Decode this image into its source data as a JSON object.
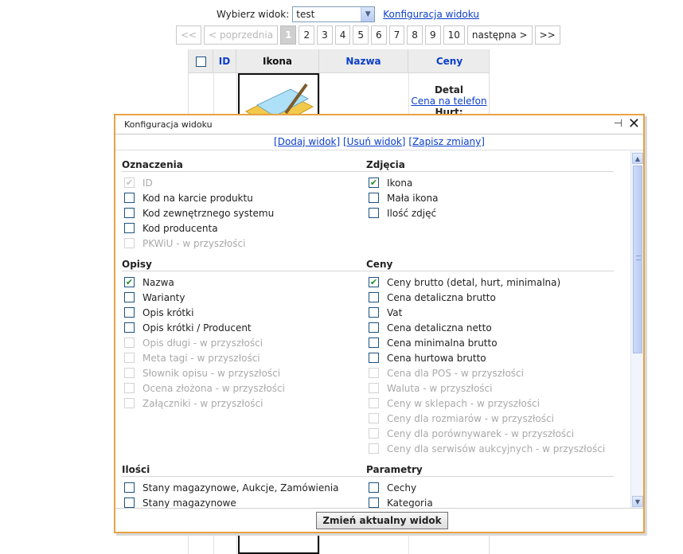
{
  "view_select": {
    "label": "Wybierz widok:",
    "selected": "test",
    "config_link": "Konfiguracja widoku"
  },
  "pager": {
    "first": "<<",
    "prev": "< poprzednia",
    "pages": [
      "1",
      "2",
      "3",
      "4",
      "5",
      "6",
      "7",
      "8",
      "9",
      "10"
    ],
    "current": "1",
    "next": "następna >",
    "last": ">>"
  },
  "table": {
    "headers": {
      "id": "ID",
      "icon": "Ikona",
      "name": "Nazwa",
      "prices": "Ceny"
    },
    "row1": {
      "price_label": "Detal",
      "price_link": "Cena na telefon",
      "hurt_label": "Hurt:"
    }
  },
  "dialog": {
    "title": "Konfiguracja widoku",
    "actions": {
      "add": "[Dodaj widok]",
      "remove": "[Usuń widok]",
      "save": "[Zapisz zmiany]"
    },
    "sections": {
      "oznaczenia": {
        "title": "Oznaczenia",
        "items": [
          {
            "label": "ID",
            "checked": true,
            "disabled": true
          },
          {
            "label": "Kod na karcie produktu",
            "checked": false,
            "disabled": false
          },
          {
            "label": "Kod zewnętrznego systemu",
            "checked": false,
            "disabled": false
          },
          {
            "label": "Kod producenta",
            "checked": false,
            "disabled": false
          },
          {
            "label": "PKWiU - w przyszłości",
            "checked": false,
            "disabled": true
          }
        ]
      },
      "zdjecia": {
        "title": "Zdjęcia",
        "items": [
          {
            "label": "Ikona",
            "checked": true,
            "disabled": false
          },
          {
            "label": "Mała ikona",
            "checked": false,
            "disabled": false
          },
          {
            "label": "Ilość zdjęć",
            "checked": false,
            "disabled": false
          }
        ]
      },
      "opisy": {
        "title": "Opisy",
        "items": [
          {
            "label": "Nazwa",
            "checked": true,
            "disabled": false
          },
          {
            "label": "Warianty",
            "checked": false,
            "disabled": false
          },
          {
            "label": "Opis krótki",
            "checked": false,
            "disabled": false
          },
          {
            "label": "Opis krótki / Producent",
            "checked": false,
            "disabled": false
          },
          {
            "label": "Opis długi - w przyszłości",
            "checked": false,
            "disabled": true
          },
          {
            "label": "Meta tagi - w przyszłości",
            "checked": false,
            "disabled": true
          },
          {
            "label": "Słownik opisu - w przyszłości",
            "checked": false,
            "disabled": true
          },
          {
            "label": "Ocena złożona - w przyszłości",
            "checked": false,
            "disabled": true
          },
          {
            "label": "Załączniki - w przyszłości",
            "checked": false,
            "disabled": true
          }
        ]
      },
      "ceny": {
        "title": "Ceny",
        "items": [
          {
            "label": "Ceny brutto (detal, hurt, minimalna)",
            "checked": true,
            "disabled": false
          },
          {
            "label": "Cena detaliczna brutto",
            "checked": false,
            "disabled": false
          },
          {
            "label": "Vat",
            "checked": false,
            "disabled": false
          },
          {
            "label": "Cena detaliczna netto",
            "checked": false,
            "disabled": false
          },
          {
            "label": "Cena minimalna brutto",
            "checked": false,
            "disabled": false
          },
          {
            "label": "Cena hurtowa brutto",
            "checked": false,
            "disabled": false
          },
          {
            "label": "Cena dla POS - w przyszłości",
            "checked": false,
            "disabled": true
          },
          {
            "label": "Waluta - w przyszłości",
            "checked": false,
            "disabled": true
          },
          {
            "label": "Ceny w sklepach - w przyszłości",
            "checked": false,
            "disabled": true
          },
          {
            "label": "Ceny dla rozmiarów - w przyszłości",
            "checked": false,
            "disabled": true
          },
          {
            "label": "Ceny dla porównywarek - w przyszłości",
            "checked": false,
            "disabled": true
          },
          {
            "label": "Ceny dla serwisów aukcyjnych - w przyszłości",
            "checked": false,
            "disabled": true
          }
        ]
      },
      "ilosci": {
        "title": "Ilości",
        "items": [
          {
            "label": "Stany magazynowe, Aukcje, Zamówienia",
            "checked": false,
            "disabled": false
          },
          {
            "label": "Stany magazynowe",
            "checked": false,
            "disabled": false
          }
        ]
      },
      "parametry": {
        "title": "Parametry",
        "items": [
          {
            "label": "Cechy",
            "checked": false,
            "disabled": false
          },
          {
            "label": "Kategoria",
            "checked": false,
            "disabled": false
          }
        ]
      }
    },
    "submit_label": "Zmień aktualny widok"
  }
}
